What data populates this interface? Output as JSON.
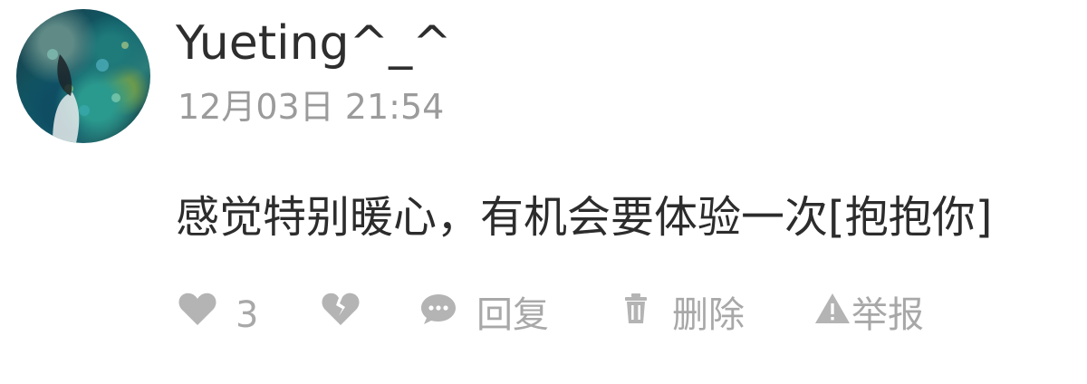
{
  "comment": {
    "username": "Yueting^_^",
    "timestamp": "12月03日 21:54",
    "text": "感觉特别暖心，有机会要体验一次[抱抱你]",
    "avatar_icon": "avatar-peacock-image",
    "actions": {
      "like_count": "3",
      "reply_label": "回复",
      "delete_label": "删除",
      "report_label": "举报"
    }
  },
  "colors": {
    "username": "#2e2e2e",
    "timestamp": "#9b9b9b",
    "body": "#2c2c2c",
    "action": "#a8a8a8"
  }
}
